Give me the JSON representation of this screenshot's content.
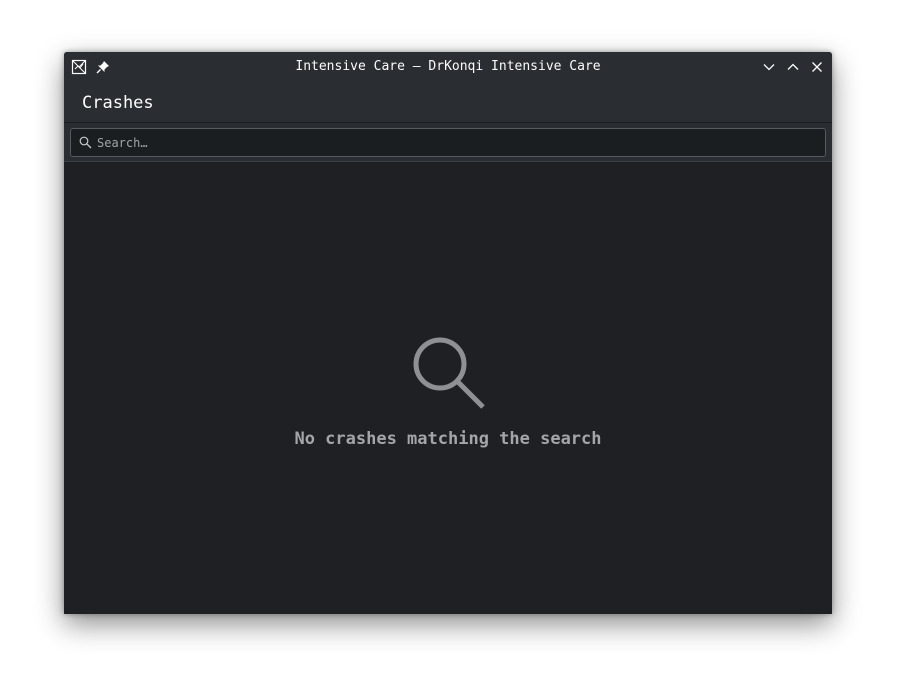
{
  "window": {
    "title": "Intensive Care — DrKonqi Intensive Care",
    "icons": {
      "app": "app-crash-icon",
      "pin": "pin-icon",
      "minimize": "chevron-down-icon",
      "maximize": "chevron-up-icon",
      "close": "close-icon"
    }
  },
  "header": {
    "title": "Crashes"
  },
  "search": {
    "placeholder": "Search…",
    "value": "",
    "icon": "search-icon"
  },
  "empty_state": {
    "icon": "search-icon",
    "message": "No crashes matching the search"
  },
  "colors": {
    "titlebar_bg": "#2a2e32",
    "content_bg": "#1e2024",
    "text": "#fcfcfc",
    "muted_text": "#a3a5a8"
  }
}
